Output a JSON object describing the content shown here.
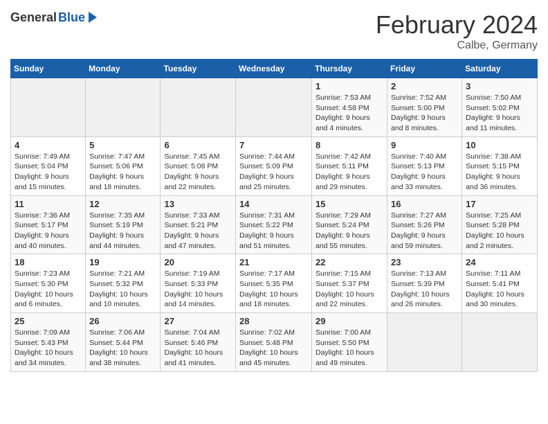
{
  "header": {
    "logo_general": "General",
    "logo_blue": "Blue",
    "title": "February 2024",
    "subtitle": "Calbe, Germany"
  },
  "days_of_week": [
    "Sunday",
    "Monday",
    "Tuesday",
    "Wednesday",
    "Thursday",
    "Friday",
    "Saturday"
  ],
  "weeks": [
    [
      {
        "day": "",
        "info": ""
      },
      {
        "day": "",
        "info": ""
      },
      {
        "day": "",
        "info": ""
      },
      {
        "day": "",
        "info": ""
      },
      {
        "day": "1",
        "info": "Sunrise: 7:53 AM\nSunset: 4:58 PM\nDaylight: 9 hours and 4 minutes."
      },
      {
        "day": "2",
        "info": "Sunrise: 7:52 AM\nSunset: 5:00 PM\nDaylight: 9 hours and 8 minutes."
      },
      {
        "day": "3",
        "info": "Sunrise: 7:50 AM\nSunset: 5:02 PM\nDaylight: 9 hours and 11 minutes."
      }
    ],
    [
      {
        "day": "4",
        "info": "Sunrise: 7:49 AM\nSunset: 5:04 PM\nDaylight: 9 hours and 15 minutes."
      },
      {
        "day": "5",
        "info": "Sunrise: 7:47 AM\nSunset: 5:06 PM\nDaylight: 9 hours and 18 minutes."
      },
      {
        "day": "6",
        "info": "Sunrise: 7:45 AM\nSunset: 5:08 PM\nDaylight: 9 hours and 22 minutes."
      },
      {
        "day": "7",
        "info": "Sunrise: 7:44 AM\nSunset: 5:09 PM\nDaylight: 9 hours and 25 minutes."
      },
      {
        "day": "8",
        "info": "Sunrise: 7:42 AM\nSunset: 5:11 PM\nDaylight: 9 hours and 29 minutes."
      },
      {
        "day": "9",
        "info": "Sunrise: 7:40 AM\nSunset: 5:13 PM\nDaylight: 9 hours and 33 minutes."
      },
      {
        "day": "10",
        "info": "Sunrise: 7:38 AM\nSunset: 5:15 PM\nDaylight: 9 hours and 36 minutes."
      }
    ],
    [
      {
        "day": "11",
        "info": "Sunrise: 7:36 AM\nSunset: 5:17 PM\nDaylight: 9 hours and 40 minutes."
      },
      {
        "day": "12",
        "info": "Sunrise: 7:35 AM\nSunset: 5:19 PM\nDaylight: 9 hours and 44 minutes."
      },
      {
        "day": "13",
        "info": "Sunrise: 7:33 AM\nSunset: 5:21 PM\nDaylight: 9 hours and 47 minutes."
      },
      {
        "day": "14",
        "info": "Sunrise: 7:31 AM\nSunset: 5:22 PM\nDaylight: 9 hours and 51 minutes."
      },
      {
        "day": "15",
        "info": "Sunrise: 7:29 AM\nSunset: 5:24 PM\nDaylight: 9 hours and 55 minutes."
      },
      {
        "day": "16",
        "info": "Sunrise: 7:27 AM\nSunset: 5:26 PM\nDaylight: 9 hours and 59 minutes."
      },
      {
        "day": "17",
        "info": "Sunrise: 7:25 AM\nSunset: 5:28 PM\nDaylight: 10 hours and 2 minutes."
      }
    ],
    [
      {
        "day": "18",
        "info": "Sunrise: 7:23 AM\nSunset: 5:30 PM\nDaylight: 10 hours and 6 minutes."
      },
      {
        "day": "19",
        "info": "Sunrise: 7:21 AM\nSunset: 5:32 PM\nDaylight: 10 hours and 10 minutes."
      },
      {
        "day": "20",
        "info": "Sunrise: 7:19 AM\nSunset: 5:33 PM\nDaylight: 10 hours and 14 minutes."
      },
      {
        "day": "21",
        "info": "Sunrise: 7:17 AM\nSunset: 5:35 PM\nDaylight: 10 hours and 18 minutes."
      },
      {
        "day": "22",
        "info": "Sunrise: 7:15 AM\nSunset: 5:37 PM\nDaylight: 10 hours and 22 minutes."
      },
      {
        "day": "23",
        "info": "Sunrise: 7:13 AM\nSunset: 5:39 PM\nDaylight: 10 hours and 26 minutes."
      },
      {
        "day": "24",
        "info": "Sunrise: 7:11 AM\nSunset: 5:41 PM\nDaylight: 10 hours and 30 minutes."
      }
    ],
    [
      {
        "day": "25",
        "info": "Sunrise: 7:09 AM\nSunset: 5:43 PM\nDaylight: 10 hours and 34 minutes."
      },
      {
        "day": "26",
        "info": "Sunrise: 7:06 AM\nSunset: 5:44 PM\nDaylight: 10 hours and 38 minutes."
      },
      {
        "day": "27",
        "info": "Sunrise: 7:04 AM\nSunset: 5:46 PM\nDaylight: 10 hours and 41 minutes."
      },
      {
        "day": "28",
        "info": "Sunrise: 7:02 AM\nSunset: 5:48 PM\nDaylight: 10 hours and 45 minutes."
      },
      {
        "day": "29",
        "info": "Sunrise: 7:00 AM\nSunset: 5:50 PM\nDaylight: 10 hours and 49 minutes."
      },
      {
        "day": "",
        "info": ""
      },
      {
        "day": "",
        "info": ""
      }
    ]
  ]
}
